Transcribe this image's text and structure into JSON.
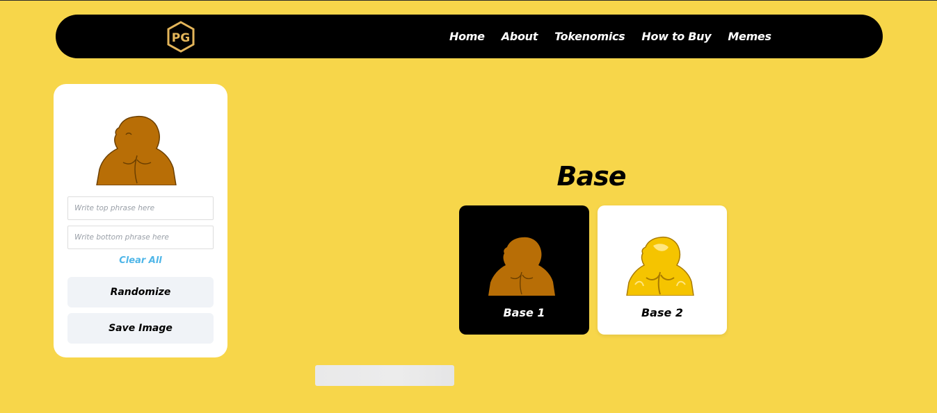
{
  "nav": {
    "logo_text": "PG",
    "links": [
      "Home",
      "About",
      "Tokenomics",
      "How to Buy",
      "Memes"
    ]
  },
  "editor": {
    "top_placeholder": "Write top phrase here",
    "bottom_placeholder": "Write bottom phrase here",
    "clear_label": "Clear All",
    "randomize_label": "Randomize",
    "save_label": "Save Image"
  },
  "base_section": {
    "title": "Base",
    "options": [
      {
        "label": "Base 1"
      },
      {
        "label": "Base 2"
      }
    ]
  },
  "colors": {
    "background": "#F7D64A",
    "nav_bg": "#000000",
    "accent_link": "#4FB6E8",
    "bear_brown": "#B86E06",
    "bear_gold": "#F5C400"
  }
}
